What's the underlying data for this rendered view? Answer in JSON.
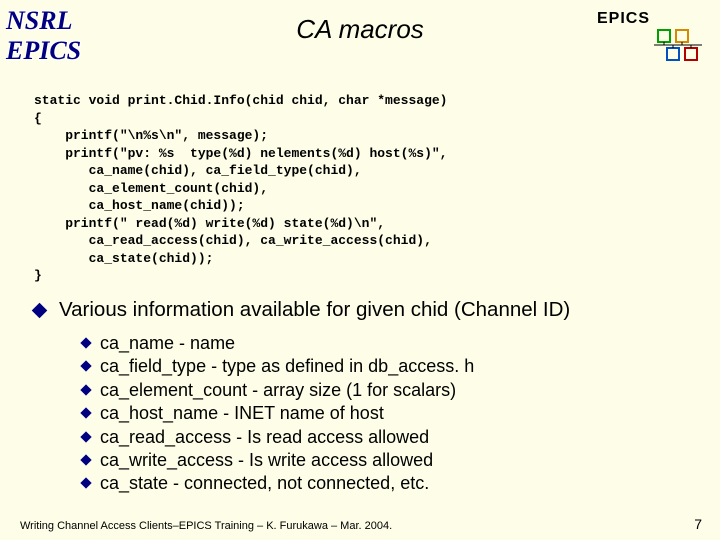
{
  "leftLabels": {
    "top": "NSRL",
    "bottom": "EPICS"
  },
  "title": "CA macros",
  "epicsLabel": "EPICS",
  "code": "static void print.Chid.Info(chid chid, char *message)\n{\n    printf(\"\\n%s\\n\", message);\n    printf(\"pv: %s  type(%d) nelements(%d) host(%s)\",\n       ca_name(chid), ca_field_type(chid),\n       ca_element_count(chid),\n       ca_host_name(chid));\n    printf(\" read(%d) write(%d) state(%d)\\n\",\n       ca_read_access(chid), ca_write_access(chid),\n       ca_state(chid));\n}",
  "mainBullet": "Various information available for given chid (Channel ID)",
  "subItems": [
    "ca_name  - name",
    "ca_field_type -  type as defined in db_access. h",
    "ca_element_count - array size (1 for scalars)",
    "ca_host_name - INET name of host",
    "ca_read_access - Is read access  allowed",
    "ca_write_access - Is write access allowed",
    "ca_state - connected, not connected, etc."
  ],
  "footer": "Writing Channel Access Clients–EPICS Training – K. Furukawa – Mar. 2004.",
  "pageNumber": "7",
  "logoColors": {
    "a": "#00a000",
    "b": "#d48a00",
    "c": "#0050c0",
    "d": "#b00000"
  }
}
